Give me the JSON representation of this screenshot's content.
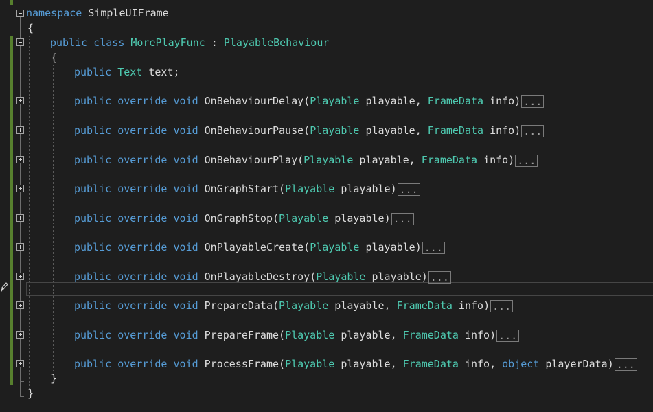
{
  "code": {
    "namespace_kw": "namespace",
    "namespace_name": "SimpleUIFrame",
    "open_brace": "{",
    "close_brace": "}",
    "class_public": "public",
    "class_kw": "class",
    "class_name": "MorePlayFunc",
    "class_colon": " : ",
    "class_base": "PlayableBehaviour",
    "field_public": "public",
    "field_type": "Text",
    "field_name": " text;",
    "collapsed_label": "...",
    "methods": [
      {
        "mod1": "public",
        "mod2": "override",
        "ret": "void",
        "name": "OnBehaviourDelay",
        "p1t": "Playable",
        "p1n": " playable, ",
        "p2t": "FrameData",
        "p2n": " info",
        "p3t": "",
        "p3n": "",
        "close": ")"
      },
      {
        "mod1": "public",
        "mod2": "override",
        "ret": "void",
        "name": "OnBehaviourPause",
        "p1t": "Playable",
        "p1n": " playable, ",
        "p2t": "FrameData",
        "p2n": " info",
        "p3t": "",
        "p3n": "",
        "close": ")"
      },
      {
        "mod1": "public",
        "mod2": "override",
        "ret": "void",
        "name": "OnBehaviourPlay",
        "p1t": "Playable",
        "p1n": " playable, ",
        "p2t": "FrameData",
        "p2n": " info",
        "p3t": "",
        "p3n": "",
        "close": ")"
      },
      {
        "mod1": "public",
        "mod2": "override",
        "ret": "void",
        "name": "OnGraphStart",
        "p1t": "Playable",
        "p1n": " playable",
        "p2t": "",
        "p2n": "",
        "p3t": "",
        "p3n": "",
        "close": ")"
      },
      {
        "mod1": "public",
        "mod2": "override",
        "ret": "void",
        "name": "OnGraphStop",
        "p1t": "Playable",
        "p1n": " playable",
        "p2t": "",
        "p2n": "",
        "p3t": "",
        "p3n": "",
        "close": ")"
      },
      {
        "mod1": "public",
        "mod2": "override",
        "ret": "void",
        "name": "OnPlayableCreate",
        "p1t": "Playable",
        "p1n": " playable",
        "p2t": "",
        "p2n": "",
        "p3t": "",
        "p3n": "",
        "close": ")"
      },
      {
        "mod1": "public",
        "mod2": "override",
        "ret": "void",
        "name": "OnPlayableDestroy",
        "p1t": "Playable",
        "p1n": " playable",
        "p2t": "",
        "p2n": "",
        "p3t": "",
        "p3n": "",
        "close": ")"
      },
      {
        "mod1": "public",
        "mod2": "override",
        "ret": "void",
        "name": "PrepareData",
        "p1t": "Playable",
        "p1n": " playable, ",
        "p2t": "FrameData",
        "p2n": " info",
        "p3t": "",
        "p3n": "",
        "close": ")"
      },
      {
        "mod1": "public",
        "mod2": "override",
        "ret": "void",
        "name": "PrepareFrame",
        "p1t": "Playable",
        "p1n": " playable, ",
        "p2t": "FrameData",
        "p2n": " info",
        "p3t": "",
        "p3n": "",
        "close": ")"
      },
      {
        "mod1": "public",
        "mod2": "override",
        "ret": "void",
        "name": "ProcessFrame",
        "p1t": "Playable",
        "p1n": " playable, ",
        "p2t": "FrameData",
        "p2n": " info, ",
        "p3t": "object",
        "p3n": " playerData",
        "close": ")"
      }
    ]
  }
}
